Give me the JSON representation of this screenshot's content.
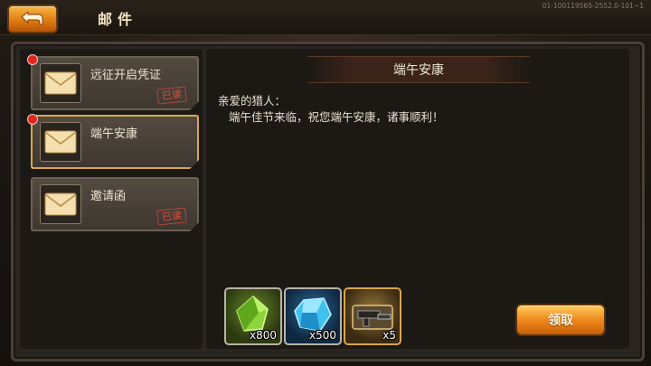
{
  "header": {
    "title": "邮件",
    "version": "01-100119565-2552.0-101~1"
  },
  "mail_list": [
    {
      "title": "远征开启凭证",
      "status": "已读",
      "unread": true,
      "selected": false
    },
    {
      "title": "端午安康",
      "status": "",
      "unread": true,
      "selected": true
    },
    {
      "title": "邀请函",
      "status": "已读",
      "unread": false,
      "selected": false
    }
  ],
  "message": {
    "title": "端午安康",
    "greeting": "亲爱的猎人：",
    "body": "端午佳节来临，祝您端午安康，诸事顺利！"
  },
  "rewards": [
    {
      "icon": "green-gem-icon",
      "qty": "x800"
    },
    {
      "icon": "blue-crystal-icon",
      "qty": "x500"
    },
    {
      "icon": "gun-parts-icon",
      "qty": "x5"
    }
  ],
  "actions": {
    "claim_label": "领取"
  },
  "colors": {
    "accent": "#f08a1c",
    "selected_border": "#d9a64d",
    "unread_dot": "#e0261b",
    "read_stamp": "#c24b3d"
  }
}
